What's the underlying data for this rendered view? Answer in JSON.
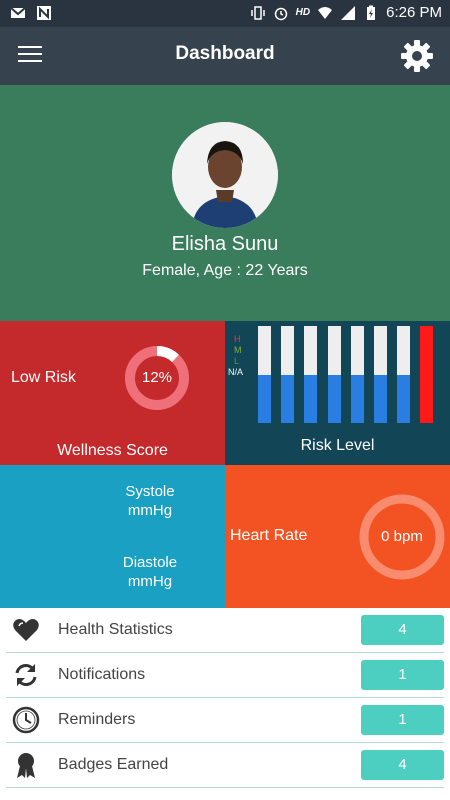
{
  "status_bar": {
    "hd": "HD",
    "time": "6:26 PM"
  },
  "app_bar": {
    "title": "Dashboard"
  },
  "profile": {
    "name": "Elisha Sunu",
    "subinfo": "Female, Age : 22 Years"
  },
  "wellness": {
    "risk_text": "Low Risk",
    "score_text": "12%",
    "score_fraction": 0.12,
    "label": "Wellness Score"
  },
  "risk_level": {
    "label": "Risk Level",
    "legend": {
      "h": "H",
      "m": "M",
      "l": "L",
      "na": "N/A"
    },
    "levels": [
      0.5,
      0.5,
      0.5,
      0.5,
      0.5,
      0.5,
      0.5,
      1.0
    ],
    "colors": {
      "track": "#eeeeee",
      "fill": "#2a7de1",
      "alert": "#ff1a1a"
    }
  },
  "blood_pressure": {
    "systole": "Systole",
    "systole_unit": "mmHg",
    "diastole": "Diastole",
    "diastole_unit": "mmHg"
  },
  "heart_rate": {
    "label": "Heart Rate",
    "value_text": "0 bpm"
  },
  "list": [
    {
      "label": "Health Statistics",
      "count": "4",
      "icon": "heart-icon"
    },
    {
      "label": "Notifications",
      "count": "1",
      "icon": "refresh-icon"
    },
    {
      "label": "Reminders",
      "count": "1",
      "icon": "clock-icon"
    },
    {
      "label": "Badges Earned",
      "count": "4",
      "icon": "ribbon-icon"
    }
  ],
  "colors": {
    "status_bar": "#2a3440",
    "app_bar": "#36424e",
    "profile_bg": "#3a7d5c",
    "wellness_bg": "#c4292b",
    "risk_bg": "#124555",
    "bp_bg": "#1aa0c3",
    "heart_bg": "#f35322",
    "badge": "#4ccfc0"
  }
}
